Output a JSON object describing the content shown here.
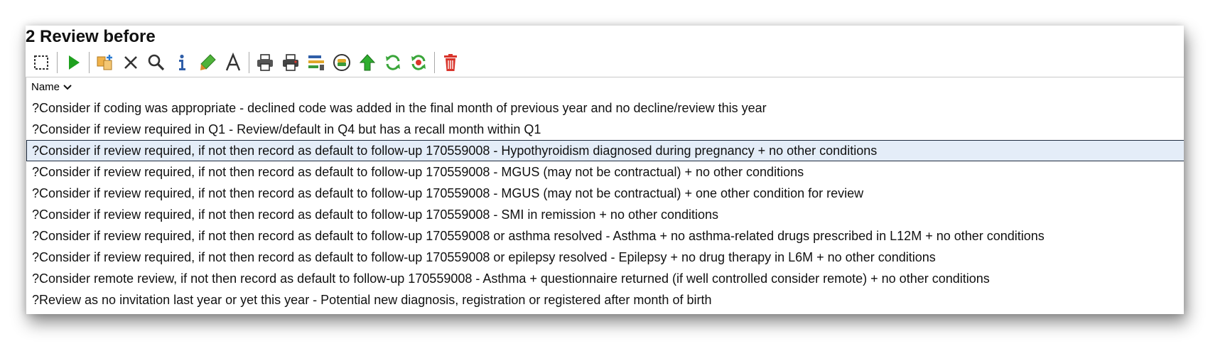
{
  "window": {
    "title": "2 Review before"
  },
  "toolbar": {
    "buttons": [
      {
        "icon": "select-all-icon"
      },
      {
        "icon": "run-icon"
      },
      {
        "icon": "add-to-group-icon"
      },
      {
        "icon": "close-icon"
      },
      {
        "icon": "search-icon"
      },
      {
        "icon": "info-icon"
      },
      {
        "icon": "highlight-icon"
      },
      {
        "icon": "font-icon"
      },
      {
        "icon": "print-icon"
      },
      {
        "icon": "print-preview-icon"
      },
      {
        "icon": "report-icon"
      },
      {
        "icon": "batch-icon"
      },
      {
        "icon": "move-up-icon"
      },
      {
        "icon": "refresh-icon"
      },
      {
        "icon": "refresh-stop-icon"
      },
      {
        "icon": "delete-icon"
      }
    ]
  },
  "list": {
    "column_header": "Name",
    "selected_index": 2,
    "rows": [
      {
        "label": "?Consider if coding was appropriate - declined code was added in the final month of previous year and no decline/review this year"
      },
      {
        "label": "?Consider if review required in Q1 - Review/default in Q4 but has a recall month within Q1"
      },
      {
        "label": "?Consider if review required, if not then record as default to follow-up 170559008 - Hypothyroidism diagnosed during pregnancy + no other conditions"
      },
      {
        "label": "?Consider if review required, if not then record as default to follow-up 170559008 - MGUS (may not be contractual) + no other conditions"
      },
      {
        "label": "?Consider if review required, if not then record as default to follow-up 170559008 - MGUS (may not be contractual) + one other condition for review"
      },
      {
        "label": "?Consider if review required, if not then record as default to follow-up 170559008 - SMI in remission + no other conditions"
      },
      {
        "label": "?Consider if review required, if not then record as default to follow-up 170559008 or asthma resolved - Asthma + no asthma-related drugs prescribed in L12M + no other conditions"
      },
      {
        "label": "?Consider if review required, if not then record as default to follow-up 170559008 or epilepsy resolved - Epilepsy + no drug therapy in L6M + no other conditions"
      },
      {
        "label": "?Consider remote review, if not then record as default to follow-up 170559008 - Asthma + questionnaire returned (if well controlled consider remote) + no other conditions"
      },
      {
        "label": "?Review as no invitation last year or yet this year - Potential new diagnosis, registration or registered after month of birth"
      }
    ]
  },
  "colors": {
    "selection_bg": "#e4edf8",
    "selection_border": "#1f2c3f",
    "run_green": "#1fa01f",
    "delete_red": "#d9342b"
  }
}
